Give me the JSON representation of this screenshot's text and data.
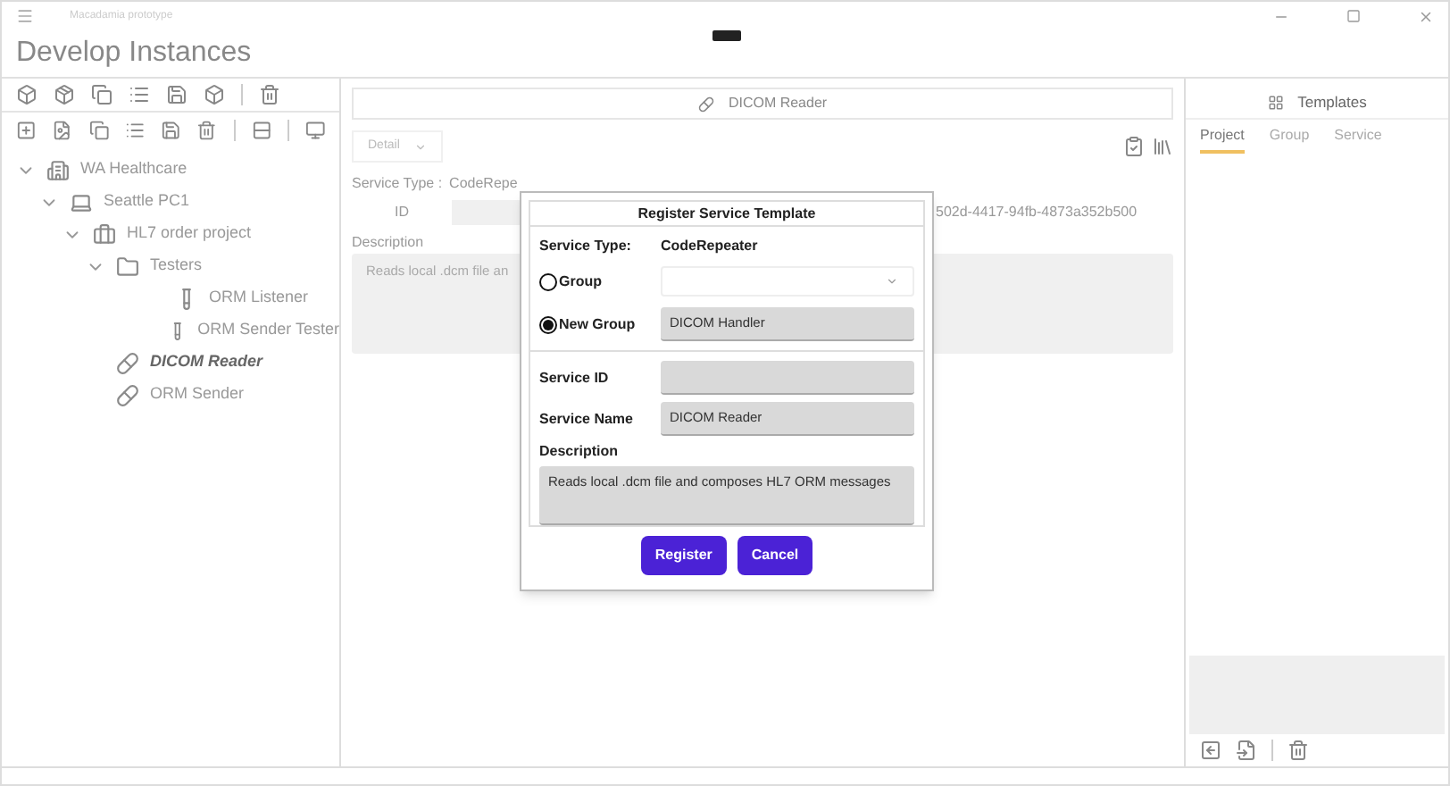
{
  "window": {
    "title": "Macadamia prototype"
  },
  "header": {
    "title": "Develop Instances"
  },
  "tree": [
    {
      "kind": "building",
      "label": "WA Healthcare",
      "expanded": true,
      "selected": false,
      "children": [
        {
          "kind": "laptop",
          "label": "Seattle PC1",
          "expanded": true,
          "selected": false,
          "children": [
            {
              "kind": "briefcase",
              "label": "HL7 order project",
              "expanded": true,
              "selected": false,
              "children": [
                {
                  "kind": "folder",
                  "label": "Testers",
                  "expanded": true,
                  "selected": false,
                  "children": [
                    {
                      "kind": "tube",
                      "label": "ORM Listener",
                      "selected": false
                    },
                    {
                      "kind": "tube",
                      "label": "ORM Sender Tester",
                      "selected": false
                    }
                  ]
                },
                {
                  "kind": "pill",
                  "label": "DICOM Reader",
                  "selected": true
                },
                {
                  "kind": "pill",
                  "label": "ORM Sender",
                  "selected": false
                }
              ]
            }
          ]
        }
      ]
    }
  ],
  "center": {
    "title": "DICOM Reader",
    "view_select": "Detail",
    "service_type_label": "Service Type :",
    "service_type_value": "CodeRepe",
    "id_label": "ID",
    "id_value": "502d-4417-94fb-4873a352b500",
    "description_label": "Description",
    "description": "Reads local .dcm file an"
  },
  "templates": {
    "title": "Templates",
    "tabs": [
      {
        "label": "Project",
        "selected": true
      },
      {
        "label": "Group",
        "selected": false
      },
      {
        "label": "Service",
        "selected": false
      }
    ]
  },
  "dialog": {
    "title": "Register Service Template",
    "service_type_label": "Service Type:",
    "service_type_value": "CodeRepeater",
    "options": [
      {
        "label": "Group",
        "selected": false,
        "kind": "select"
      },
      {
        "label": "New Group",
        "selected": true,
        "kind": "text",
        "value": "DICOM Handler"
      }
    ],
    "service_id_label": "Service ID",
    "service_name_label": "Service Name",
    "service_name_value": "DICOM Reader",
    "description_label": "Description",
    "description": "Reads local .dcm file and composes HL7 ORM messages",
    "buttons": [
      "Register",
      "Cancel"
    ]
  }
}
